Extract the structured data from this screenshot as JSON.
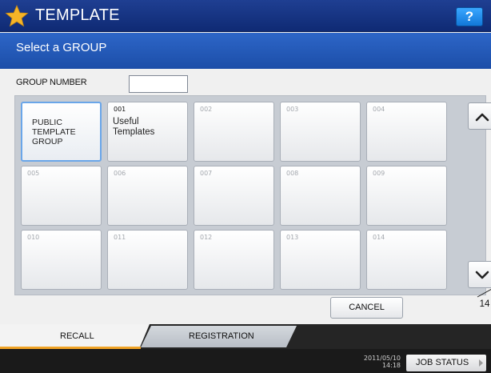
{
  "title_bar": {
    "title": "TEMPLATE",
    "icon": "star-icon",
    "help_label": "?"
  },
  "subtitle": "Select a GROUP",
  "group_number": {
    "label": "GROUP NUMBER",
    "value": ""
  },
  "groups": [
    {
      "number": "",
      "name": "PUBLIC\nTEMPLATE\nGROUP",
      "selected": true
    },
    {
      "number": "001",
      "name": "Useful\nTemplates"
    },
    {
      "number": "002",
      "name": ""
    },
    {
      "number": "003",
      "name": ""
    },
    {
      "number": "004",
      "name": ""
    },
    {
      "number": "005",
      "name": ""
    },
    {
      "number": "006",
      "name": ""
    },
    {
      "number": "007",
      "name": ""
    },
    {
      "number": "008",
      "name": ""
    },
    {
      "number": "009",
      "name": ""
    },
    {
      "number": "010",
      "name": ""
    },
    {
      "number": "011",
      "name": ""
    },
    {
      "number": "012",
      "name": ""
    },
    {
      "number": "013",
      "name": ""
    },
    {
      "number": "014",
      "name": ""
    }
  ],
  "pagination": {
    "current": "1",
    "total": "14"
  },
  "cancel_label": "CANCEL",
  "tabs": {
    "recall": "RECALL",
    "registration": "REGISTRATION"
  },
  "status": {
    "date": "2011/05/10",
    "time": "14:18",
    "job_status_label": "JOB STATUS"
  },
  "colors": {
    "title_bar": "#1f3f92",
    "sub_bar": "#2d66c8",
    "help_button": "#1a8af0",
    "star": "#f5b428",
    "tab_underline": "#f0a326"
  }
}
